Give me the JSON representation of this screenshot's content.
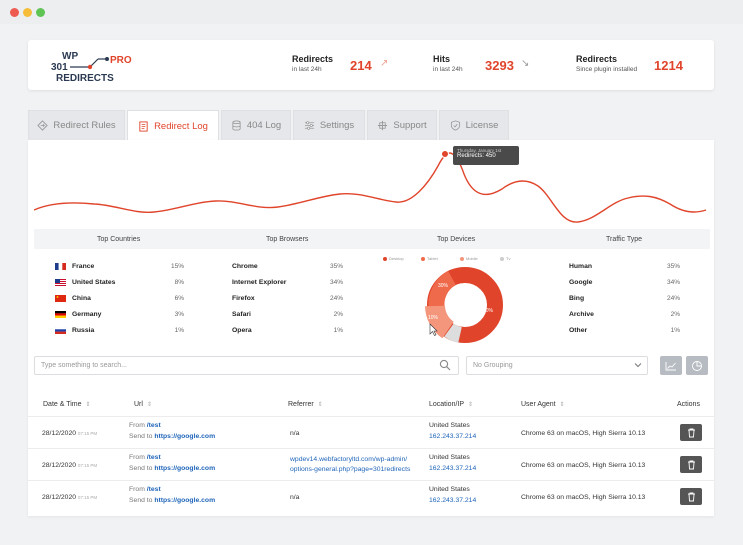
{
  "header": {
    "logo_line1": "WP",
    "logo_num": "301",
    "logo_pro": "PRO",
    "logo_line2": "REDIRECTS",
    "stats": [
      {
        "title": "Redirects",
        "sub": "in last 24h",
        "value": "214",
        "trend": "up"
      },
      {
        "title": "Hits",
        "sub": "in last 24h",
        "value": "3293",
        "trend": "down"
      },
      {
        "title": "Redirects",
        "sub": "Since plugin installed",
        "value": "1214",
        "trend": "none"
      }
    ]
  },
  "tabs": [
    {
      "label": "Redirect Rules",
      "icon": "redirect-icon",
      "active": false
    },
    {
      "label": "Redirect Log",
      "icon": "log-icon",
      "active": true
    },
    {
      "label": "404 Log",
      "icon": "database-icon",
      "active": false
    },
    {
      "label": "Settings",
      "icon": "sliders-icon",
      "active": false
    },
    {
      "label": "Support",
      "icon": "support-icon",
      "active": false
    },
    {
      "label": "License",
      "icon": "shield-icon",
      "active": false
    }
  ],
  "chart": {
    "tooltip_date": "Thursday, January 1st",
    "tooltip_value": "Redirects: 450",
    "line_color": "#e0452b"
  },
  "stats_panel": {
    "countries_title": "Top Countries",
    "browsers_title": "Top Browsers",
    "devices_title": "Top Devices",
    "traffic_title": "Traffic Type",
    "countries": [
      {
        "name": "France",
        "pct": "15%",
        "flag": "france-flag-icon"
      },
      {
        "name": "United States",
        "pct": "8%",
        "flag": "usa-flag-icon"
      },
      {
        "name": "China",
        "pct": "6%",
        "flag": "china-flag-icon"
      },
      {
        "name": "Germany",
        "pct": "3%",
        "flag": "germany-flag-icon"
      },
      {
        "name": "Russia",
        "pct": "1%",
        "flag": "russia-flag-icon"
      }
    ],
    "browsers": [
      {
        "name": "Chrome",
        "pct": "35%"
      },
      {
        "name": "Internet Explorer",
        "pct": "34%"
      },
      {
        "name": "Firefox",
        "pct": "24%"
      },
      {
        "name": "Safari",
        "pct": "2%"
      },
      {
        "name": "Opera",
        "pct": "1%"
      }
    ],
    "devices_legend": [
      "Desktop",
      "Tablet",
      "Mobile",
      "Tv"
    ],
    "devices_labels": [
      "30%",
      "60%",
      "10%"
    ],
    "traffic": [
      {
        "name": "Human",
        "pct": "35%"
      },
      {
        "name": "Google",
        "pct": "34%"
      },
      {
        "name": "Bing",
        "pct": "24%"
      },
      {
        "name": "Archive",
        "pct": "2%"
      },
      {
        "name": "Other",
        "pct": "1%"
      }
    ]
  },
  "filters": {
    "search_placeholder": "Type something to search...",
    "grouping_value": "No Grouping"
  },
  "table": {
    "headers": [
      "Date & Time",
      "Url",
      "Referrer",
      "Location/IP",
      "User Agent",
      "Actions"
    ],
    "from_label": "From",
    "sendto_label": "Send to",
    "rows": [
      {
        "date": "28/12/2020",
        "time": "07:15 PM",
        "from": "/test",
        "to": "https://google.com",
        "referrer1": "n/a",
        "referrer2": "",
        "location": "United States",
        "ip": "162.243.37.214",
        "agent": "Chrome 63 on macOS, High Sierra 10.13"
      },
      {
        "date": "28/12/2020",
        "time": "07:15 PM",
        "from": "/test",
        "to": "https://google.com",
        "referrer1": "wpdev14.webfactoryltd.com/wp-admin/",
        "referrer2": "options-general.php?page=301redirects",
        "location": "United States",
        "ip": "162.243.37.214",
        "agent": "Chrome 63 on macOS, High Sierra 10.13"
      },
      {
        "date": "28/12/2020",
        "time": "07:15 PM",
        "from": "/test",
        "to": "https://google.com",
        "referrer1": "n/a",
        "referrer2": "",
        "location": "United States",
        "ip": "162.243.37.214",
        "agent": "Chrome 63 on macOS, High Sierra 10.13"
      }
    ]
  }
}
